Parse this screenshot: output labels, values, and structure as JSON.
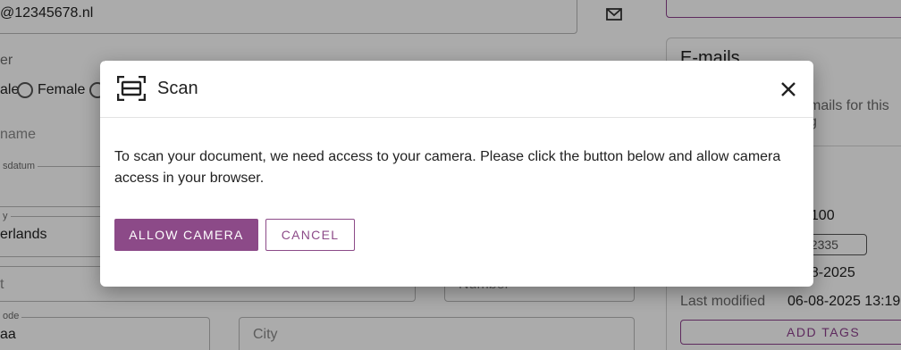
{
  "background": {
    "email_value": "@12345678.nl",
    "gender_label": "er",
    "gender_options": [
      "ale",
      "Female"
    ],
    "lastname_placeholder": "name",
    "birthdate_label": "sdatum",
    "country_label": "y",
    "country_value": "erlands",
    "street_placeholder": "t",
    "number_placeholder": "Number",
    "postcode_label": "ode",
    "postcode_value": "aa",
    "city_placeholder": "City",
    "emails_title": "E-mails",
    "emails_subtitle": "mails for this g",
    "info_value_1": "9100",
    "tag_value": "02335",
    "date_value": "08-2025",
    "last_modified_label": "Last modified",
    "last_modified_value": "06-08-2025 13:19",
    "add_tags_label": "ADD TAGS"
  },
  "dialog": {
    "icon": "scan-icon",
    "title": "Scan",
    "close_icon": "close-icon",
    "body": "To scan your document, we need access to your camera. Please click the button below and allow camera access in your browser.",
    "allow_label": "ALLOW CAMERA",
    "cancel_label": "CANCEL"
  },
  "colors": {
    "accent": "#8c4a88",
    "overlay": "rgba(0,0,0,0.33)"
  }
}
